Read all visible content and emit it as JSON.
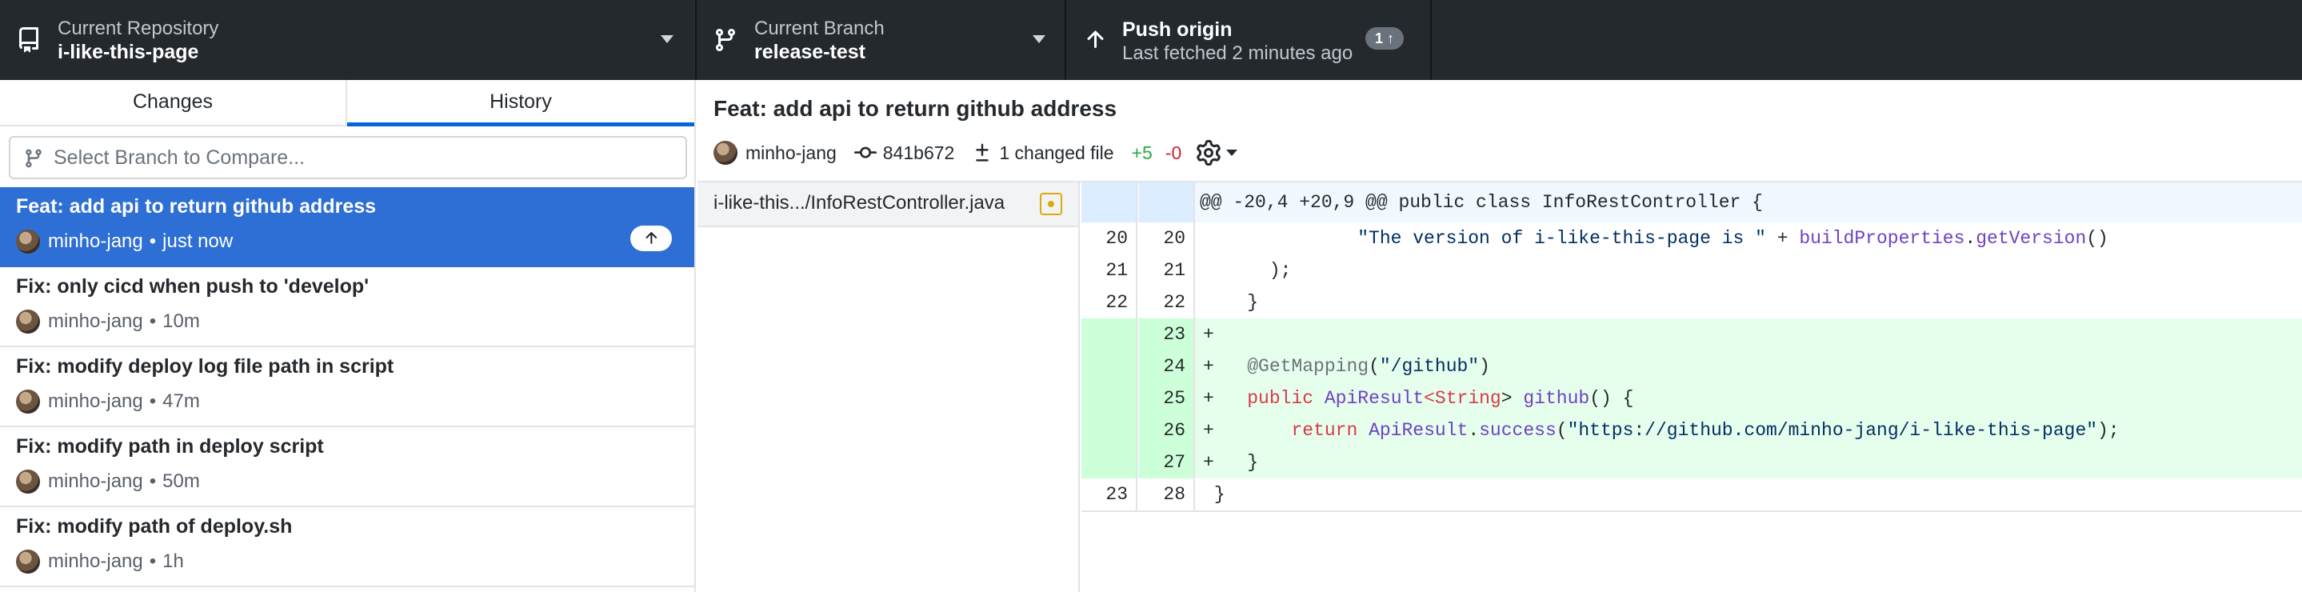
{
  "toolbar": {
    "repository": {
      "label": "Current Repository",
      "value": "i-like-this-page"
    },
    "branch": {
      "label": "Current Branch",
      "value": "release-test"
    },
    "push": {
      "label": "Push origin",
      "subtext": "Last fetched 2 minutes ago",
      "badge": "1 ↑"
    }
  },
  "sidebar": {
    "tabs": [
      {
        "label": "Changes",
        "active": false
      },
      {
        "label": "History",
        "active": true
      }
    ],
    "compare_placeholder": "Select Branch to Compare...",
    "commits": [
      {
        "title": "Feat: add api to return github address",
        "author": "minho-jang",
        "separator": "•",
        "time": "just now",
        "selected": true,
        "unpushed": true
      },
      {
        "title": "Fix: only cicd when push to 'develop'",
        "author": "minho-jang",
        "separator": "•",
        "time": "10m",
        "selected": false
      },
      {
        "title": "Fix: modify deploy log file path in script",
        "author": "minho-jang",
        "separator": "•",
        "time": "47m",
        "selected": false
      },
      {
        "title": "Fix: modify path in deploy script",
        "author": "minho-jang",
        "separator": "•",
        "time": "50m",
        "selected": false
      },
      {
        "title": "Fix: modify path of deploy.sh",
        "author": "minho-jang",
        "separator": "•",
        "time": "1h",
        "selected": false
      }
    ]
  },
  "commit_header": {
    "summary": "Feat: add api to return github address",
    "author": "minho-jang",
    "sha": "841b672",
    "changed_files": "1 changed file",
    "additions": "+5",
    "deletions": "-0"
  },
  "files": [
    {
      "path": "i-like-this.../InfoRestController.java",
      "status": "modified"
    }
  ],
  "diff": {
    "hunk_header": "@@ -20,4 +20,9 @@ public class InfoRestController {",
    "lines": [
      {
        "type": "context",
        "old": "20",
        "new": "20"
      },
      {
        "type": "context",
        "old": "21",
        "new": "21"
      },
      {
        "type": "context",
        "old": "22",
        "new": "22"
      },
      {
        "type": "added",
        "old": "",
        "new": "23"
      },
      {
        "type": "added",
        "old": "",
        "new": "24"
      },
      {
        "type": "added",
        "old": "",
        "new": "25"
      },
      {
        "type": "added",
        "old": "",
        "new": "26"
      },
      {
        "type": "added",
        "old": "",
        "new": "27"
      },
      {
        "type": "context",
        "old": "23",
        "new": "28"
      }
    ],
    "code": {
      "l20_str": "\"The version of i-like-this-page is \"",
      "l20_plus": "+",
      "l20_obj": "buildProperties",
      "l20_dot": ".",
      "l20_method": "getVersion",
      "l20_end": "()",
      "l21": ");",
      "l22": "}",
      "l23": "+",
      "l24_prefix": "+",
      "l24_annotation": "@GetMapping",
      "l24_open": "(",
      "l24_str": "\"/github\"",
      "l24_close": ")",
      "l25_prefix": "+",
      "l25_public": "public",
      "l25_type": "ApiResult",
      "l25_lt": "<",
      "l25_generic": "String",
      "l25_gt": ">",
      "l25_name": "github",
      "l25_rest": "() {",
      "l26_prefix": "+",
      "l26_return": "return",
      "l26_type": "ApiResult",
      "l26_dot": ".",
      "l26_method": "success",
      "l26_open": "(",
      "l26_str": "\"https://github.com/minho-jang/i-like-this-page\"",
      "l26_close": ");",
      "l27_prefix": "+",
      "l27_brace": "}",
      "l28": "}"
    }
  },
  "colors": {
    "toolbar_bg": "#24292e",
    "selected_commit": "#2d6fd5",
    "added_bg": "#e6ffed",
    "hunk_bg": "#f1f8ff",
    "addition_text": "#28a745",
    "deletion_text": "#cb2431",
    "active_tab": "#0366d6"
  },
  "icons": {
    "repo": "repo-icon",
    "branch": "git-branch-icon",
    "push": "arrow-up-icon",
    "commit": "git-commit-icon",
    "diff": "diff-icon",
    "settings": "gear-icon",
    "file_status": "file-modified-icon"
  }
}
